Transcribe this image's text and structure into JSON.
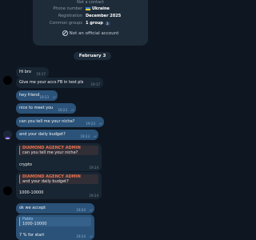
{
  "info_card": {
    "top_text": "Not a contact",
    "rows": [
      {
        "label": "Phone number",
        "value": "Ukraine"
      },
      {
        "label": "Registration",
        "value": "December 2025"
      },
      {
        "label": "Common groups",
        "value": "1 group",
        "chip": "3"
      }
    ],
    "official": "Not an official account"
  },
  "date": "February 3",
  "messages": {
    "m1": {
      "text": "Hi bro",
      "time": "19:17"
    },
    "m2": {
      "text": "Give me your accs FB in test pls",
      "time": "19:17"
    },
    "m3": {
      "text": "hey friend",
      "time": "19:23"
    },
    "m4": {
      "text": "nice to meet you",
      "time": "19:23"
    },
    "m5": {
      "text": "can you tell me your niche?",
      "time": "19:23"
    },
    "m6": {
      "text": "and your daily budget?",
      "time": "19:23"
    },
    "m7": {
      "quote_name": "DIAMOND AGENCY ADMIN",
      "quote_text": "can you tell me your niche?",
      "text": "crypto",
      "time": "19:24"
    },
    "m8": {
      "quote_name": "DIAMOND AGENCY ADMIN",
      "quote_text": "and your daily budget?",
      "text": "1000-10000",
      "time": "19:24"
    },
    "m9": {
      "text": "ok we accept",
      "time": "19:24"
    },
    "m10": {
      "quote_name": "Pablo",
      "quote_text": "1000-10000",
      "text": "7 % for start",
      "time": "19:24"
    }
  },
  "icons": {
    "check": "double-check-icon",
    "avatar": "agency-avatar-icon",
    "blocked": "not-official-icon"
  }
}
